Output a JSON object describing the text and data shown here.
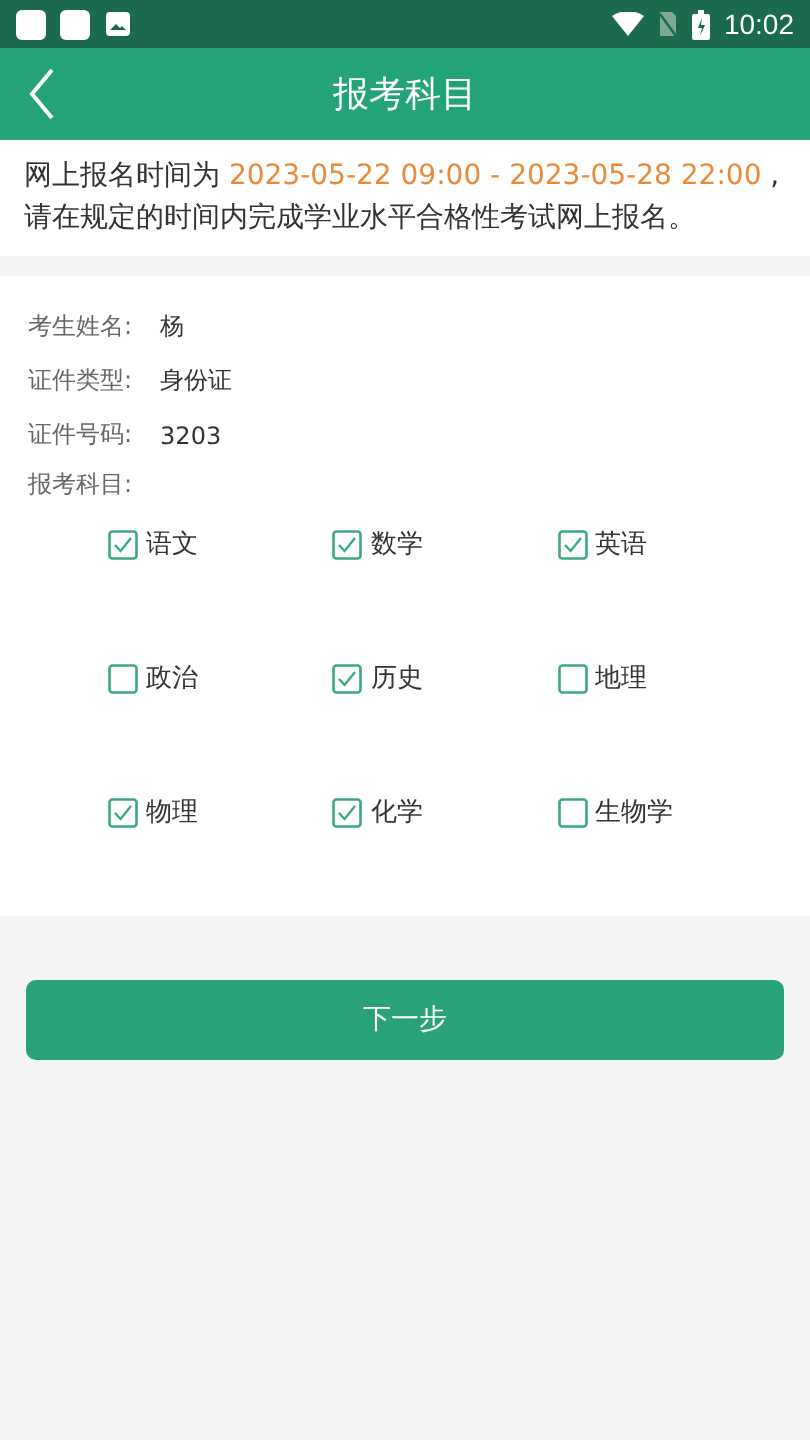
{
  "status_bar": {
    "time": "10:02"
  },
  "header": {
    "title": "报考科目"
  },
  "notice": {
    "before": "网上报名时间为 ",
    "period": "2023-05-22 09:00 - 2023-05-28 22:00",
    "after": " ,请在规定的时间内完成学业水平合格性考试网上报名。"
  },
  "fields": [
    {
      "label": "考生姓名:",
      "value": "杨"
    },
    {
      "label": "证件类型:",
      "value": "身份证"
    },
    {
      "label": "证件号码:",
      "value": "3203"
    }
  ],
  "subjects_label": "报考科目:",
  "subjects": [
    {
      "name": "语文",
      "checked": true
    },
    {
      "name": "数学",
      "checked": true
    },
    {
      "name": "英语",
      "checked": true
    },
    {
      "name": "政治",
      "checked": false
    },
    {
      "name": "历史",
      "checked": true
    },
    {
      "name": "地理",
      "checked": false
    },
    {
      "name": "物理",
      "checked": true
    },
    {
      "name": "化学",
      "checked": true
    },
    {
      "name": "生物学",
      "checked": false
    }
  ],
  "next_button": "下一步"
}
